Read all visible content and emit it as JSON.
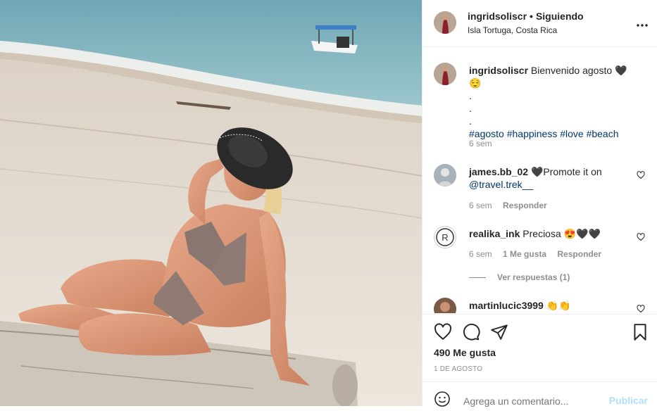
{
  "post": {
    "username": "ingridsoliscr",
    "separator": "•",
    "follow_label": "Siguiendo",
    "location": "Isla Tortuga, Costa Rica",
    "more_icon": "more-horizontal-icon"
  },
  "caption": {
    "username": "ingridsoliscr",
    "text": "Bienvenido agosto 🖤😌",
    "dots": [
      ".",
      ".",
      "."
    ],
    "hashtags": "#agosto #happiness #love #beach",
    "time": "6 sem"
  },
  "comments": [
    {
      "username": "james.bb_02",
      "text": "🖤Promote it on",
      "mention": "@travel.trek__",
      "time": "6 sem",
      "reply_label": "Responder"
    },
    {
      "username": "realika_ink",
      "text": "Preciosa 😍🖤🖤",
      "time": "6 sem",
      "likes_label": "1 Me gusta",
      "reply_label": "Responder",
      "view_replies": "Ver respuestas (1)"
    },
    {
      "username": "martinlucic3999",
      "text": "👏👏"
    }
  ],
  "actions": {
    "likes": "490 Me gusta",
    "date": "1 DE AGOSTO"
  },
  "add_comment": {
    "placeholder": "Agrega un comentario...",
    "post_label": "Publicar"
  },
  "colors": {
    "link": "#00376b",
    "muted": "#8e8e8e",
    "publish_disabled": "#b2dffc",
    "border": "#efefef"
  }
}
